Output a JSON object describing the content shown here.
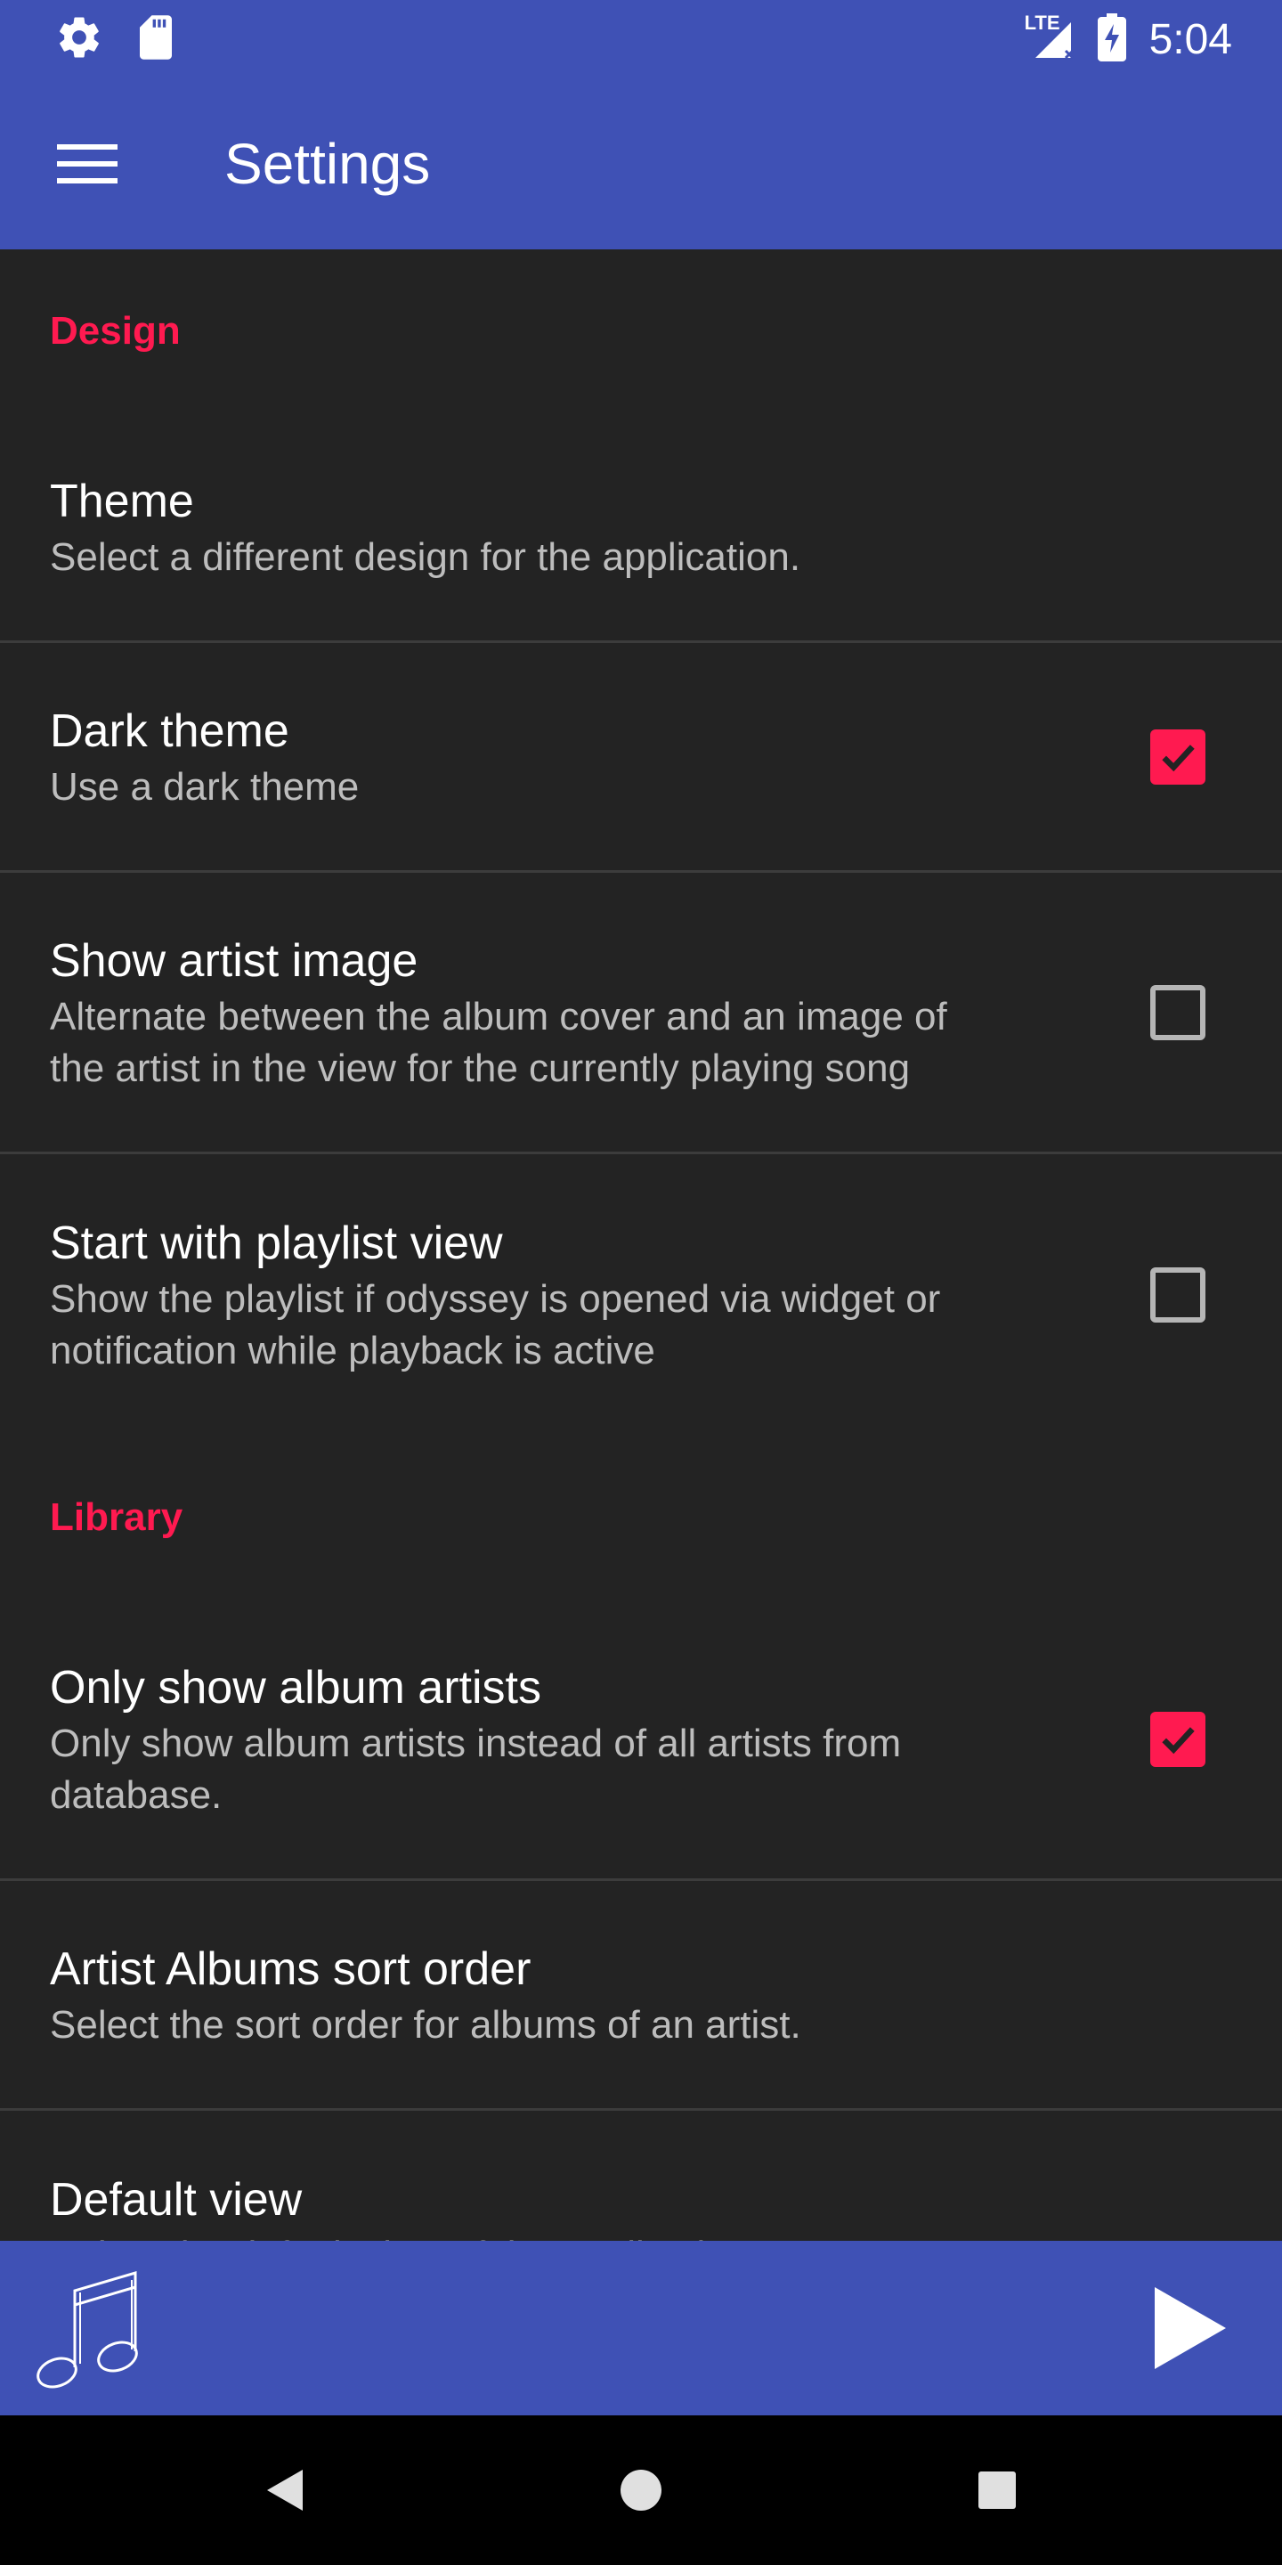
{
  "status_bar": {
    "time": "5:04",
    "network_label": "LTE",
    "icons": [
      "settings-icon",
      "sd-card-icon",
      "signal-icon",
      "battery-charging-icon"
    ]
  },
  "app_bar": {
    "title": "Settings",
    "menu_icon": "hamburger-menu-icon"
  },
  "sections": [
    {
      "header": "Design",
      "items": [
        {
          "title": "Theme",
          "summary": "Select a different design for the application."
        },
        {
          "title": "Dark theme",
          "summary": "Use a dark theme",
          "checked": true
        },
        {
          "title": "Show artist image",
          "summary_line1": "Alternate between the album cover and an image of",
          "summary_line2": "the artist in the view for the currently playing song",
          "checked": false
        },
        {
          "title": "Start with playlist view",
          "summary_line1": "Show the playlist if odyssey is opened via widget or",
          "summary_line2": "notification while playback is active",
          "checked": false
        }
      ]
    },
    {
      "header": "Library",
      "items": [
        {
          "title": "Only show album artists",
          "summary_line1": "Only show album artists instead of all artists from",
          "summary_line2": "database.",
          "checked": true
        },
        {
          "title": "Artist Albums sort order",
          "summary": "Select the sort order for albums of an artist."
        },
        {
          "title": "Default view",
          "summary": "Select the default view of the application."
        }
      ]
    }
  ],
  "now_playing": {
    "cover_icon": "music-note-icon",
    "play_icon": "play-icon"
  },
  "colors": {
    "primary": "#3f51b5",
    "accent": "#ff1a50",
    "background": "#232323"
  }
}
